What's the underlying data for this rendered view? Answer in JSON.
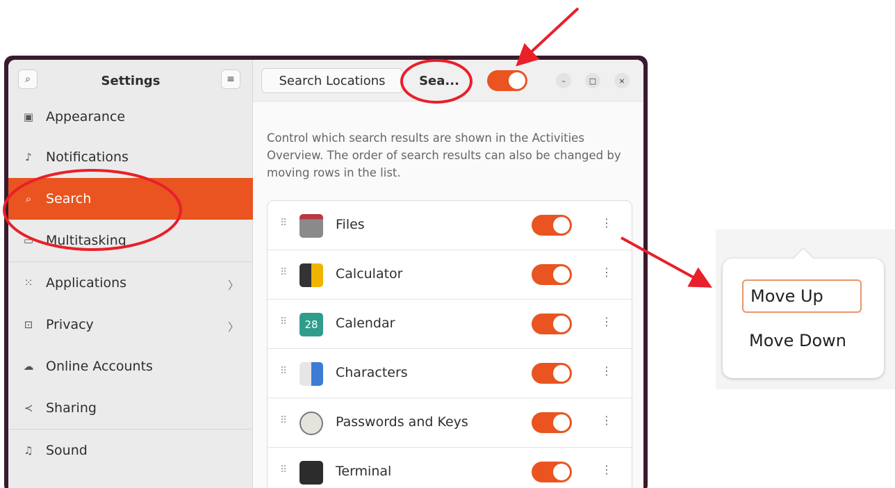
{
  "sidebar": {
    "title": "Settings",
    "items": [
      {
        "label": "Appearance",
        "icon": "appearance-icon",
        "glyph": "▣"
      },
      {
        "label": "Notifications",
        "icon": "bell-icon",
        "glyph": "🔔︎"
      },
      {
        "label": "Search",
        "icon": "search-icon",
        "glyph": "⌕"
      },
      {
        "label": "Multitasking",
        "icon": "multitasking-icon",
        "glyph": "▭"
      },
      {
        "label": "Applications",
        "icon": "grid-icon",
        "glyph": "⁙"
      },
      {
        "label": "Privacy",
        "icon": "lock-icon",
        "glyph": "⊡"
      },
      {
        "label": "Online Accounts",
        "icon": "cloud-icon",
        "glyph": "☁"
      },
      {
        "label": "Sharing",
        "icon": "share-icon",
        "glyph": "≺"
      },
      {
        "label": "Sound",
        "icon": "music-note-icon",
        "glyph": "♫"
      }
    ],
    "active": "Search",
    "search_glyph": "⌕",
    "menu_glyph": "≡",
    "chevron_glyph": "〉"
  },
  "header": {
    "tab_locations": "Search Locations",
    "tab_search": "Sea...",
    "minimize": "–",
    "maximize": "□",
    "close": "×"
  },
  "main": {
    "description": "Control which search results are shown in the Activities Overview. The order of search results can also be changed by moving rows in the list.",
    "grip_glyph": "⠿",
    "more_glyph": "⋮",
    "rows": [
      {
        "label": "Files",
        "icon": "files-folder-icon",
        "color": "#8a8a8a",
        "enabled": true
      },
      {
        "label": "Calculator",
        "icon": "calculator-icon",
        "color": "#333333",
        "enabled": true
      },
      {
        "label": "Calendar",
        "icon": "calendar-icon",
        "color": "#2f9c8c",
        "enabled": true,
        "glyph": "28"
      },
      {
        "label": "Characters",
        "icon": "characters-icon",
        "color": "#3d7bd6",
        "enabled": true
      },
      {
        "label": "Passwords and Keys",
        "icon": "passwords-keys-icon",
        "color": "#d8d8d0",
        "enabled": true
      },
      {
        "label": "Terminal",
        "icon": "terminal-icon",
        "color": "#2c2c2c",
        "enabled": true
      }
    ]
  },
  "popover": {
    "move_up": "Move Up",
    "move_down": "Move Down"
  },
  "colors": {
    "accent": "#e95420",
    "annotation": "#e8202a"
  }
}
